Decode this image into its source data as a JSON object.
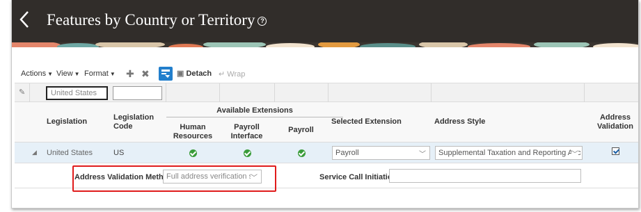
{
  "header": {
    "title": "Features by Country or Territory",
    "back_icon": "chevron-left-icon",
    "help_icon": "help-icon",
    "background_color": "#312d2a"
  },
  "toolbar": {
    "actions": "Actions",
    "view": "View",
    "format": "Format",
    "detach": "Detach",
    "wrap": "Wrap",
    "accent_color": "#227fcc"
  },
  "filters": {
    "legislation_value": "United States",
    "code_value": ""
  },
  "columns": {
    "legislation": "Legislation",
    "legislation_code": "Legislation Code",
    "available_extensions": "Available Extensions",
    "human_resources": "Human Resources",
    "payroll_interface": "Payroll Interface",
    "payroll": "Payroll",
    "selected_extension": "Selected Extension",
    "address_style": "Address Style",
    "address_validation": "Address Validation"
  },
  "row": {
    "legislation": "United States",
    "code": "US",
    "human_resources": true,
    "payroll_interface": true,
    "payroll": true,
    "selected_extension": "Payroll",
    "address_style": "Supplemental Taxation and Reporting Adc",
    "address_validation": true
  },
  "detail": {
    "validation_method_label": "Address Validation Method",
    "validation_method_value": "Full address verification se",
    "service_call_label": "Service Call Initiation",
    "service_call_value": ""
  },
  "colors": {
    "check_green": "#3a9c3a",
    "highlight_red": "#e01b1b",
    "selected_row": "#e6f0f8"
  }
}
